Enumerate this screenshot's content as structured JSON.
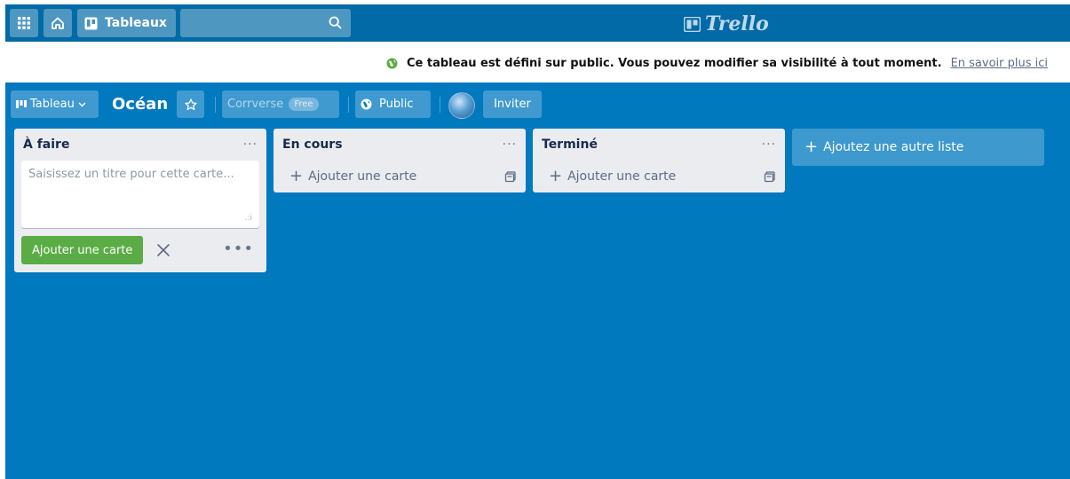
{
  "header": {
    "apps_icon": "grid-icon",
    "home_icon": "home-icon",
    "boards_label": "Tableaux",
    "search_placeholder": "",
    "logo_text": "Trello"
  },
  "notice": {
    "message": "Ce tableau est défini sur public. Vous pouvez modifier sa visibilité à tout moment.",
    "link": "En savoir plus ici"
  },
  "board": {
    "view_label": "Tableau",
    "title": "Océan",
    "team_label": "Corrverse",
    "team_badge": "Free",
    "visibility_label": "Public",
    "invite_label": "Inviter"
  },
  "lists": [
    {
      "title": "À faire",
      "menu": "···",
      "composer_placeholder": "Saisissez un titre pour cette carte...",
      "submit_label": "Ajouter une carte"
    },
    {
      "title": "En cours",
      "menu": "···",
      "add_card_label": "Ajouter une carte"
    },
    {
      "title": "Terminé",
      "menu": "···",
      "add_card_label": "Ajouter une carte"
    }
  ],
  "add_list_label": "Ajoutez une autre liste",
  "colors": {
    "header": "#026aa7",
    "board": "#0079bf",
    "list": "#ebecf0",
    "accent_green": "#5aac44"
  }
}
